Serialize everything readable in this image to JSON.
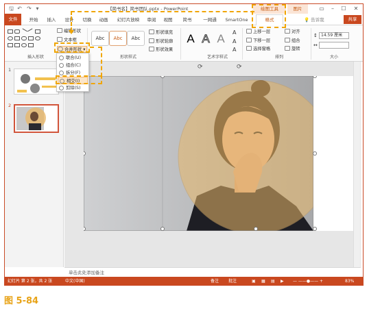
{
  "window": {
    "title": "【简书名】简书团队.pptx - PowerPoint",
    "contextual_group": "绘图工具",
    "contextual_group2": "图片"
  },
  "quick_access": {
    "save": "🖫",
    "undo": "↶",
    "redo": "↷",
    "customize": "▾"
  },
  "tabs": [
    {
      "label": "文件"
    },
    {
      "label": "开始"
    },
    {
      "label": "插入"
    },
    {
      "label": "设计"
    },
    {
      "label": "切换"
    },
    {
      "label": "动画"
    },
    {
      "label": "幻灯片放映"
    },
    {
      "label": "审阅"
    },
    {
      "label": "视图"
    },
    {
      "label": "简书"
    },
    {
      "label": "一网通"
    },
    {
      "label": "SmartOne"
    },
    {
      "label": "格式"
    }
  ],
  "tell_me": "告诉我",
  "share": "共享",
  "ribbon": {
    "edit_shape": "编辑形状",
    "text_box": "文本框",
    "merge_shapes": "合并形状",
    "insert_shapes_group": "插入形状",
    "shape_styles_group": "形状样式",
    "style_sample": "Abc",
    "shape_fill": "形状填充",
    "shape_outline": "形状轮廓",
    "shape_effects": "形状效果",
    "wordart_group": "艺术字样式",
    "wordart_letter": "A",
    "bring_forward": "上移一层",
    "send_backward": "下移一层",
    "selection_pane": "选择窗格",
    "align": "对齐",
    "group": "组合",
    "rotate": "旋转",
    "arrange_group": "排列",
    "size_group": "大小",
    "height_value": "14.59 厘米"
  },
  "merge_menu": {
    "items": [
      {
        "label": "联合(U)"
      },
      {
        "label": "组合(C)"
      },
      {
        "label": "拆分(F)"
      },
      {
        "label": "相交(I)"
      },
      {
        "label": "剪除(S)"
      }
    ],
    "active_index": 3
  },
  "thumbnails": [
    {
      "number": "1"
    },
    {
      "number": "2"
    }
  ],
  "notes_placeholder": "单击此处添加备注",
  "statusbar": {
    "slide_info": "幻灯片 第 2 张，共 2 张",
    "language": "中文(中国)",
    "notes": "备注",
    "comments": "批注",
    "zoom": "83%"
  },
  "colors": {
    "accent": "#c9481f",
    "highlight": "#f0a500",
    "circle_fill": "#e8b86a"
  },
  "caption": "图 5-84"
}
